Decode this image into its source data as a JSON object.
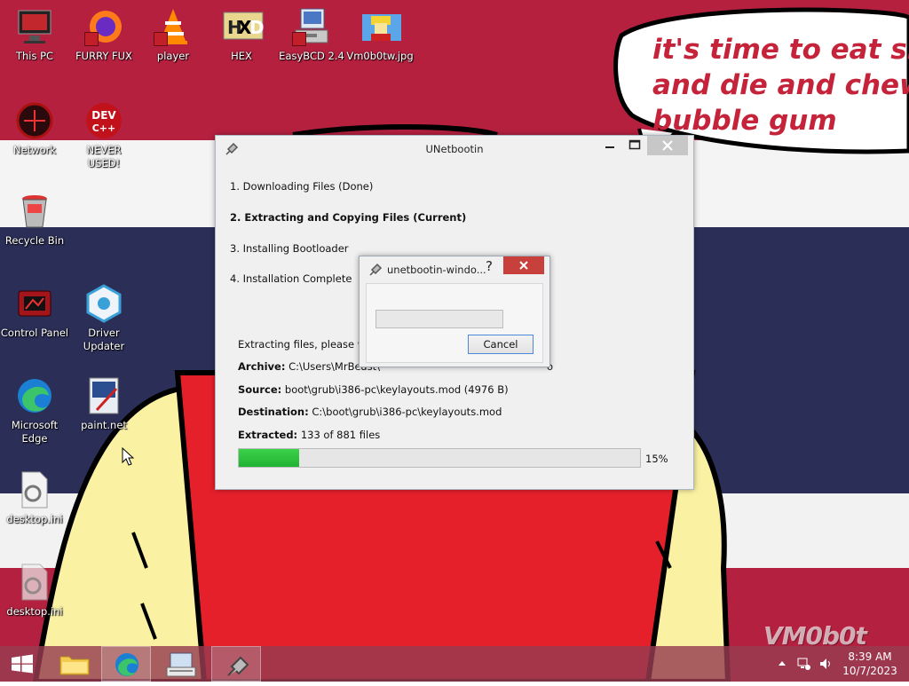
{
  "desktop": {
    "wallpaper_text": "it's time to eat shit and die and chew bubble gum",
    "wallpaper_lines": [
      "it's time to eat shit",
      "and die and chew",
      "bubble gum"
    ],
    "watermark": "VM0b0t",
    "icons": [
      {
        "label": "This PC"
      },
      {
        "label": "FURRY FUX"
      },
      {
        "label": "player"
      },
      {
        "label": "HEX"
      },
      {
        "label": "EasyBCD 2.4"
      },
      {
        "label": "Vm0b0tw.jpg"
      },
      {
        "label": "Network"
      },
      {
        "label": "NEVER USED!"
      },
      {
        "label": "Recycle Bin"
      },
      {
        "label": "Control Panel"
      },
      {
        "label": "Driver Updater"
      },
      {
        "label": "Microsoft Edge"
      },
      {
        "label": "paint.net"
      },
      {
        "label": "desktop.ini"
      },
      {
        "label": "desktop.ini"
      }
    ],
    "icon_texts": {
      "dev": "DEV",
      "dev_pp": "C++",
      "hex_x": "X",
      "hex_h": "H",
      "hex_d": "D"
    }
  },
  "unetbootin": {
    "title": "UNetbootin",
    "steps": [
      "1. Downloading Files (Done)",
      "2. Extracting and Copying Files (Current)",
      "3. Installing Bootloader",
      "4. Installation Complete"
    ],
    "status": "Extracting files, please wait...",
    "archive_label": "Archive:",
    "archive_value": "C:\\Users\\MrBeast\\",
    "archive_suffix": "o",
    "source_label": "Source:",
    "source_value": "boot\\grub\\i386-pc\\keylayouts.mod (4976 B)",
    "destination_label": "Destination:",
    "destination_value": "C:\\boot\\grub\\i386-pc\\keylayouts.mod",
    "extracted_label": "Extracted:",
    "extracted_value": "133 of 881 files",
    "progress_text": "15%",
    "progress_fraction": 0.15
  },
  "dialog": {
    "title": "unetbootin-windo...",
    "help": "?",
    "cancel_label": "Cancel"
  },
  "taskbar": {
    "time": "8:39 AM",
    "date": "10/7/2023"
  },
  "colors": {
    "stripe_red": "#b5203f",
    "stripe_blue": "#2b2e57",
    "progress_green": "#2cc23e",
    "close_red": "#c7403b"
  }
}
